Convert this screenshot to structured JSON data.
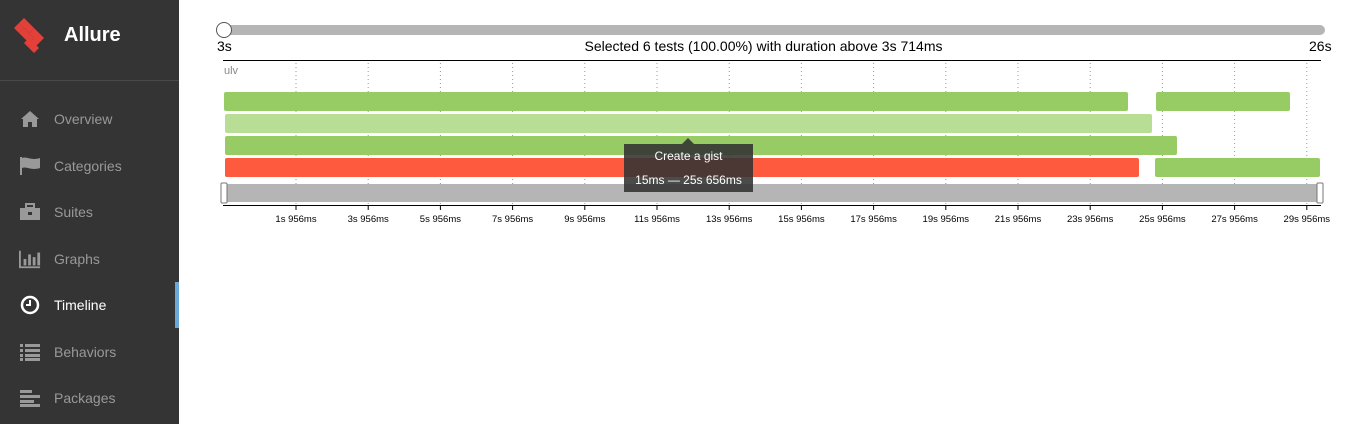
{
  "app": {
    "name": "Allure",
    "brand_color": "#e4403a"
  },
  "sidebar": {
    "items": [
      {
        "label": "Overview",
        "icon": "home-icon",
        "active": false
      },
      {
        "label": "Categories",
        "icon": "flag-icon",
        "active": false
      },
      {
        "label": "Suites",
        "icon": "briefcase-icon",
        "active": false
      },
      {
        "label": "Graphs",
        "icon": "bar-chart-icon",
        "active": false
      },
      {
        "label": "Timeline",
        "icon": "clock-icon",
        "active": true
      },
      {
        "label": "Behaviors",
        "icon": "list-icon",
        "active": false
      },
      {
        "label": "Packages",
        "icon": "align-left-icon",
        "active": false
      }
    ]
  },
  "duration_filter": {
    "min_label": "3s",
    "max_label": "26s",
    "summary": "Selected 6 tests (100.00%) with duration above 3s 714ms",
    "selected_fraction": 0.0
  },
  "timeline": {
    "host": "ulv",
    "ticks": [
      "1s 956ms",
      "3s 956ms",
      "5s 956ms",
      "7s 956ms",
      "9s 956ms",
      "11s 956ms",
      "13s 956ms",
      "15s 956ms",
      "17s 956ms",
      "19s 956ms",
      "21s 956ms",
      "23s 956ms",
      "25s 956ms",
      "27s 956ms",
      "29s 956ms"
    ],
    "colors": {
      "passed": "#97cc64",
      "passed_hover": "#b8de95",
      "failed": "#fd5a3e",
      "brush": "#b5b5b5"
    },
    "tooltip": {
      "name": "Create a gist",
      "range": "15ms — 25s 656ms"
    }
  }
}
